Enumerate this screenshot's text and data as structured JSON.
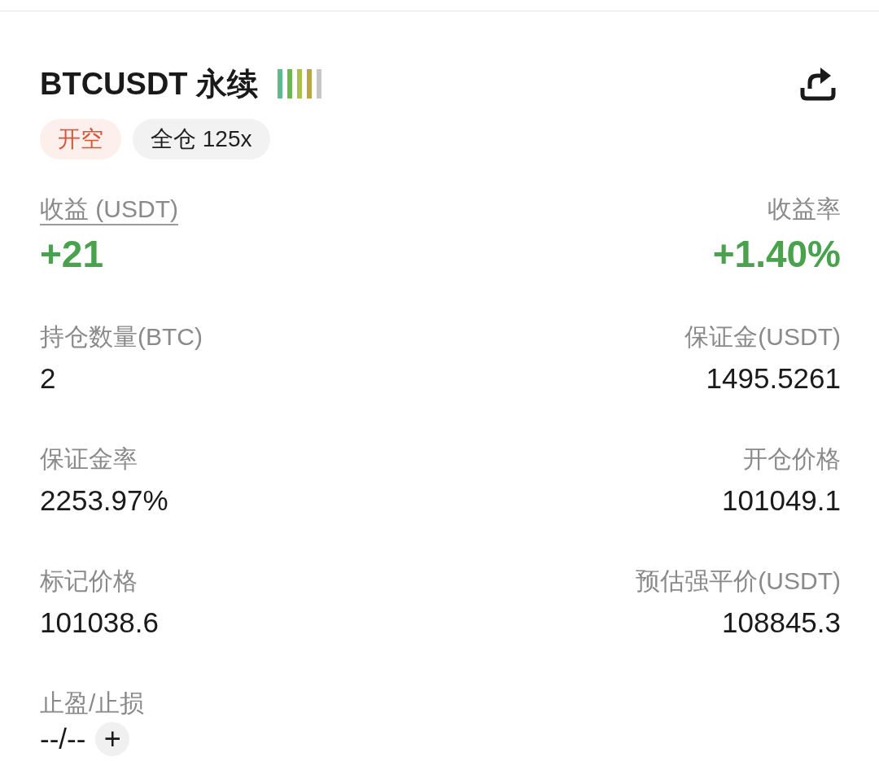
{
  "header": {
    "title": "BTCUSDT 永续",
    "adl_bars": [
      {
        "color": "#5fbb8e"
      },
      {
        "color": "#6cb84e"
      },
      {
        "color": "#a9c04b"
      },
      {
        "color": "#b8a642"
      },
      {
        "color": "#c6c6c6"
      }
    ],
    "tags": [
      {
        "kind": "side",
        "text": "开空"
      },
      {
        "kind": "margin",
        "text": "全仓 125x"
      }
    ]
  },
  "fields": [
    {
      "kind": "pnl",
      "label": "收益 (USDT)",
      "value": "+21",
      "underlined": true
    },
    {
      "kind": "pnl",
      "label": "收益率",
      "value": "+1.40%",
      "underlined": false
    },
    {
      "kind": "plain",
      "label": "持仓数量(BTC)",
      "value": "2",
      "underlined": false
    },
    {
      "kind": "plain",
      "label": "保证金(USDT)",
      "value": "1495.5261",
      "underlined": false
    },
    {
      "kind": "plain",
      "label": "保证金率",
      "value": "2253.97%",
      "underlined": false
    },
    {
      "kind": "plain",
      "label": "开仓价格",
      "value": "101049.1",
      "underlined": false
    },
    {
      "kind": "plain",
      "label": "标记价格",
      "value": "101038.6",
      "underlined": false
    },
    {
      "kind": "plain",
      "label": "预估强平价(USDT)",
      "value": "108845.3",
      "underlined": false
    },
    {
      "kind": "tpsl",
      "label": "止盈/止损",
      "value": "--/--",
      "underlined": false,
      "action": "+"
    }
  ]
}
